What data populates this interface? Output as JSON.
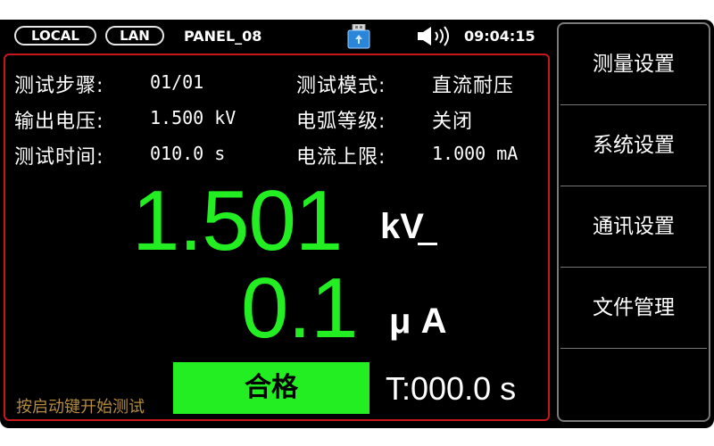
{
  "status_bar": {
    "mode": "LOCAL",
    "interface": "LAN",
    "panel_name": "PANEL_08",
    "usb_icon": "usb-drive-icon",
    "speaker_icon": "speaker-icon",
    "time": "09:04:15"
  },
  "params": {
    "step_label": "测试步骤:",
    "step_value": "01/01",
    "mode_label": "测试模式:",
    "mode_value": "直流耐压",
    "voltage_label": "输出电压:",
    "voltage_value": "1.500 kV",
    "arc_label": "电弧等级:",
    "arc_value": "关闭",
    "time_label": "测试时间:",
    "time_value": "010.0 s",
    "current_label": "电流上限:",
    "current_value": "1.000 mA"
  },
  "measurement": {
    "voltage": "1.501",
    "voltage_unit": "kV",
    "current": "0.1",
    "current_unit": "μ A"
  },
  "footer": {
    "hint": "按启动键开始测试",
    "result": "合格",
    "timer": "T:000.0 s"
  },
  "menu": {
    "items": [
      {
        "label": "测量设置"
      },
      {
        "label": "系统设置"
      },
      {
        "label": "通讯设置"
      },
      {
        "label": "文件管理"
      },
      {
        "label": ""
      }
    ]
  },
  "colors": {
    "reading": "#22ee22",
    "pass_box": "#22ee22",
    "panel_border": "#c8161d",
    "hint": "#b58c3c"
  }
}
